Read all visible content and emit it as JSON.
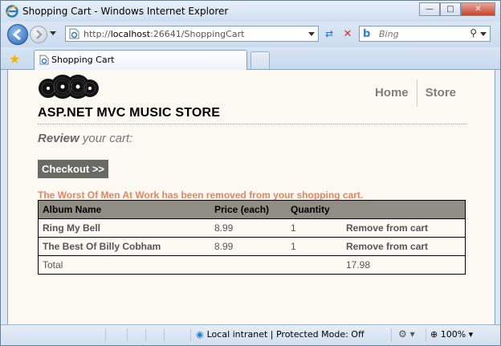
{
  "window": {
    "title": "Shopping Cart - Windows Internet Explorer"
  },
  "addressbar": {
    "url_prefix": "http://",
    "url_host": "localhost",
    "url_rest": ":26641/ShoppingCart",
    "search_placeholder": "Bing"
  },
  "tabs": [
    {
      "label": "Shopping Cart"
    }
  ],
  "site": {
    "title": "ASP.NET MVC MUSIC STORE",
    "nav": [
      {
        "label": "Home"
      },
      {
        "label": "Store"
      }
    ]
  },
  "page": {
    "review_bold": "Review",
    "review_rest": " your cart:",
    "checkout_label": "Checkout >>",
    "message": "The Worst Of Men At Work has been removed from your shopping cart."
  },
  "cart": {
    "headers": [
      "Album Name",
      "Price (each)",
      "Quantity",
      ""
    ],
    "rows": [
      {
        "album": "Ring My Bell",
        "price": "8.99",
        "quantity": "1",
        "action": "Remove from cart"
      },
      {
        "album": "The Best Of Billy Cobham",
        "price": "8.99",
        "quantity": "1",
        "action": "Remove from cart"
      }
    ],
    "total_label": "Total",
    "total_value": "17.98"
  },
  "statusbar": {
    "zone": "Local intranet | Protected Mode: Off",
    "zoom": "100%"
  },
  "colors": {
    "accent_orange": "#e8835f",
    "header_grey": "#8f8d84",
    "content_bg": "#fbf9f1"
  }
}
